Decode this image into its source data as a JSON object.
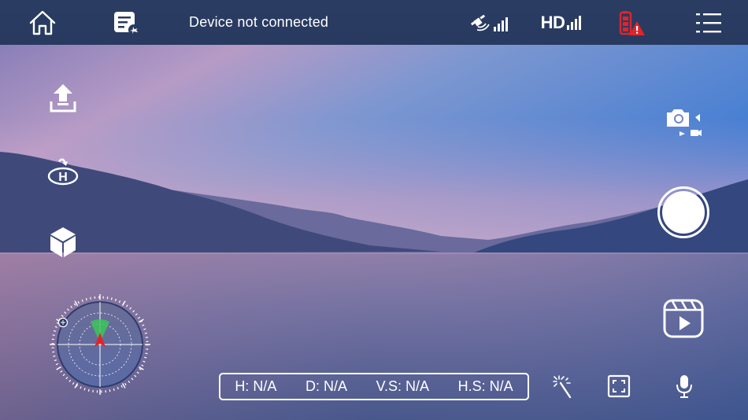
{
  "topbar": {
    "status_text": "Device not connected",
    "hd_label": "HD"
  },
  "icons": {
    "home": "home-icon",
    "flight_log": "flight-log-icon",
    "gps_signal": "satellite-signal-icon",
    "hd_signal": "hd-signal-icon",
    "battery": "battery-warning-icon",
    "menu": "menu-list-icon",
    "takeoff": "takeoff-icon",
    "return_home": "return-home-icon",
    "3d_mode": "cube-icon",
    "camera_switch": "camera-video-switch-icon",
    "shutter": "shutter-button",
    "media": "media-playback-icon",
    "magic_wand": "magic-wand-icon",
    "fullscreen": "fullscreen-icon",
    "microphone": "microphone-icon"
  },
  "telemetry": {
    "height": "H: N/A",
    "distance": "D: N/A",
    "vertical_speed": "V.S: N/A",
    "horizontal_speed": "H.S: N/A"
  },
  "colors": {
    "topbar": "#283a5f",
    "battery_alert": "#e0242b",
    "radar_green": "#3cc45a"
  }
}
